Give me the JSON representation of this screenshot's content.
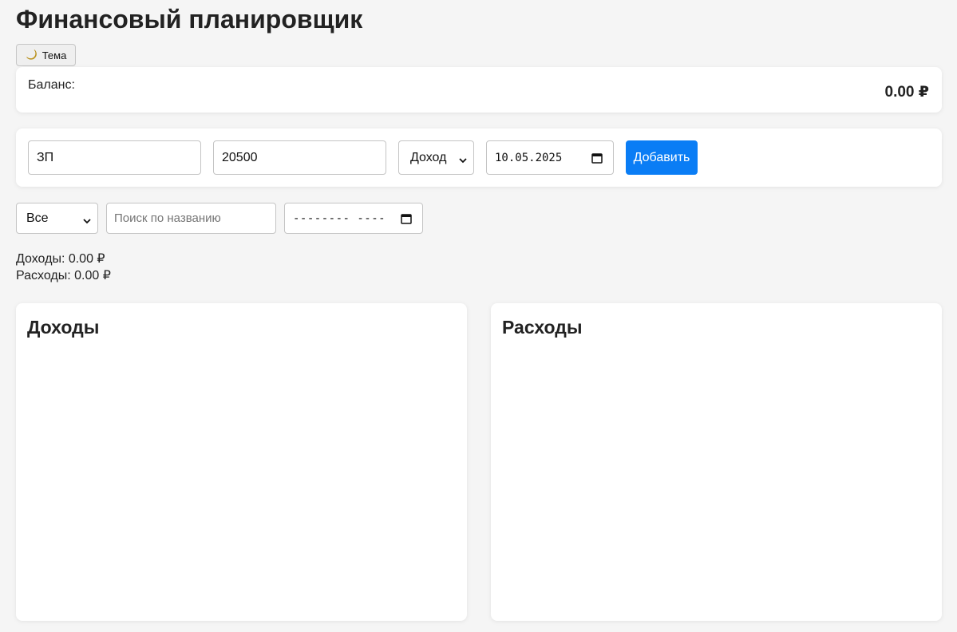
{
  "header": {
    "title": "Финансовый планировщик"
  },
  "theme_toggle": {
    "icon": "moon-icon",
    "label": "Тема"
  },
  "balance": {
    "label": "Баланс:",
    "value": "0.00 ₽"
  },
  "form": {
    "name_value": "ЗП",
    "amount_value": "20500",
    "type_selected": "Доход",
    "date_value": "10.05.2025",
    "add_label": "Добавить"
  },
  "filters": {
    "type_selected": "Все",
    "search_placeholder": "Поиск по названию",
    "date_placeholder": "-------- ----"
  },
  "totals": {
    "income": "Доходы: 0.00 ₽",
    "expense": "Расходы: 0.00 ₽"
  },
  "lists": {
    "income_title": "Доходы",
    "expense_title": "Расходы"
  },
  "colors": {
    "accent": "#0a7df5",
    "background": "#f5f5f5",
    "card": "#ffffff"
  }
}
